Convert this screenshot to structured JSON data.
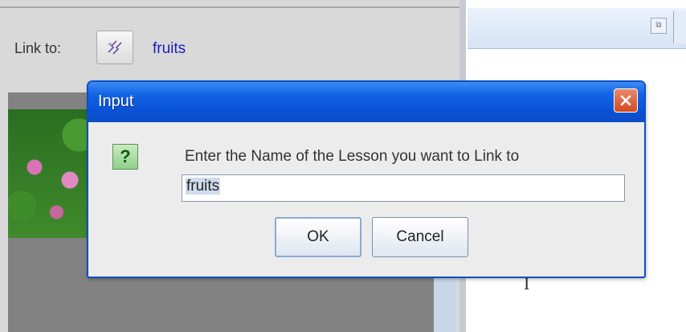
{
  "background_app": {
    "link_label": "Link to:",
    "link_value": "fruits",
    "link_button_icon": "link-picker-icon",
    "right_page_mark": "I"
  },
  "dialog": {
    "title": "Input",
    "prompt": "Enter the Name of the Lesson you want to Link to",
    "input_value": "fruits",
    "ok_label": "OK",
    "cancel_label": "Cancel",
    "question_symbol": "?"
  },
  "colors": {
    "titlebar": "#0a52d6",
    "link_text": "#1d1dc4",
    "close_button": "#d04a20"
  }
}
